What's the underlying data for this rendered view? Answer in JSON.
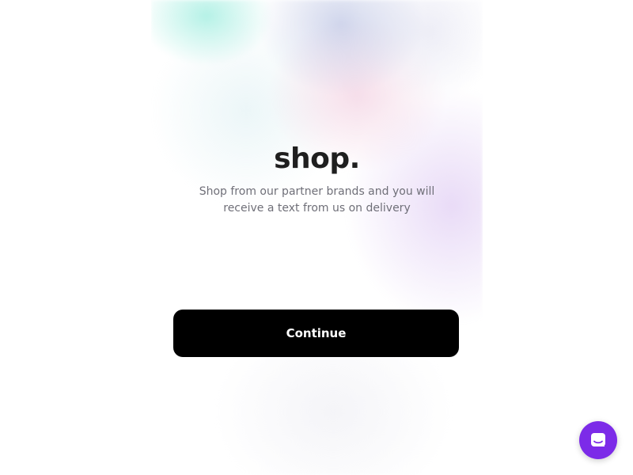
{
  "onboarding": {
    "title": "shop.",
    "subtitle": "Shop from our partner brands and you will receive a text from us on delivery",
    "continue_label": "Continue"
  },
  "chat_launcher": {
    "icon": "chat-icon",
    "color": "#7c2be8"
  },
  "colors": {
    "button_background": "#000000",
    "button_text": "#ffffff",
    "title_text": "#1f1f1f",
    "subtitle_text": "#6f6f78"
  }
}
